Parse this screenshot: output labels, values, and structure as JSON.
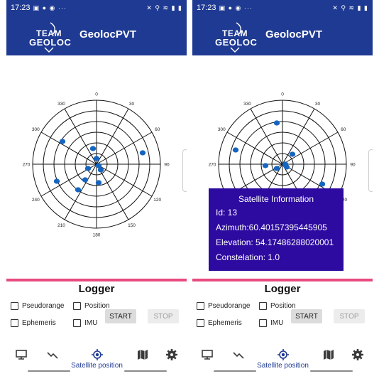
{
  "status_bar": {
    "time": "17:23"
  },
  "app": {
    "logo_line1": "TEAM",
    "logo_line2": "GEOLOC",
    "title": "GeolocPVT"
  },
  "skyplot": {
    "azimuth_labels": [
      "0",
      "30",
      "60",
      "90",
      "120",
      "150",
      "180",
      "210",
      "240",
      "270",
      "300",
      "330"
    ]
  },
  "logger": {
    "title": "Logger",
    "checkboxes": {
      "pseudorange": "Pseudorange",
      "position": "Position",
      "ephemeris": "Ephemeris",
      "imu": "IMU"
    },
    "start_label": "START",
    "stop_label": "STOP"
  },
  "nav": {
    "active_label": "Satellite position"
  },
  "satellite_info": {
    "title": "Satellite Information",
    "id": "Id: 13",
    "azimuth": "Azimuth:60.40157395445905",
    "elevation": "Elevation: 54.17486288020001",
    "constellation": "Constelation: 1.0"
  },
  "colors": {
    "appbar": "#1f3a93",
    "satellite": "#1565c0",
    "logger_bar": "#e84a7f",
    "info_box": "#2d0aa0"
  },
  "icons": [
    "image-icon",
    "facebook-icon",
    "messenger-icon",
    "more-icon",
    "mute-icon",
    "location-icon",
    "wifi-icon",
    "signal-icon",
    "battery-icon",
    "monitor-icon",
    "trend-icon",
    "gps-fix-icon",
    "map-icon",
    "settings-icon"
  ]
}
